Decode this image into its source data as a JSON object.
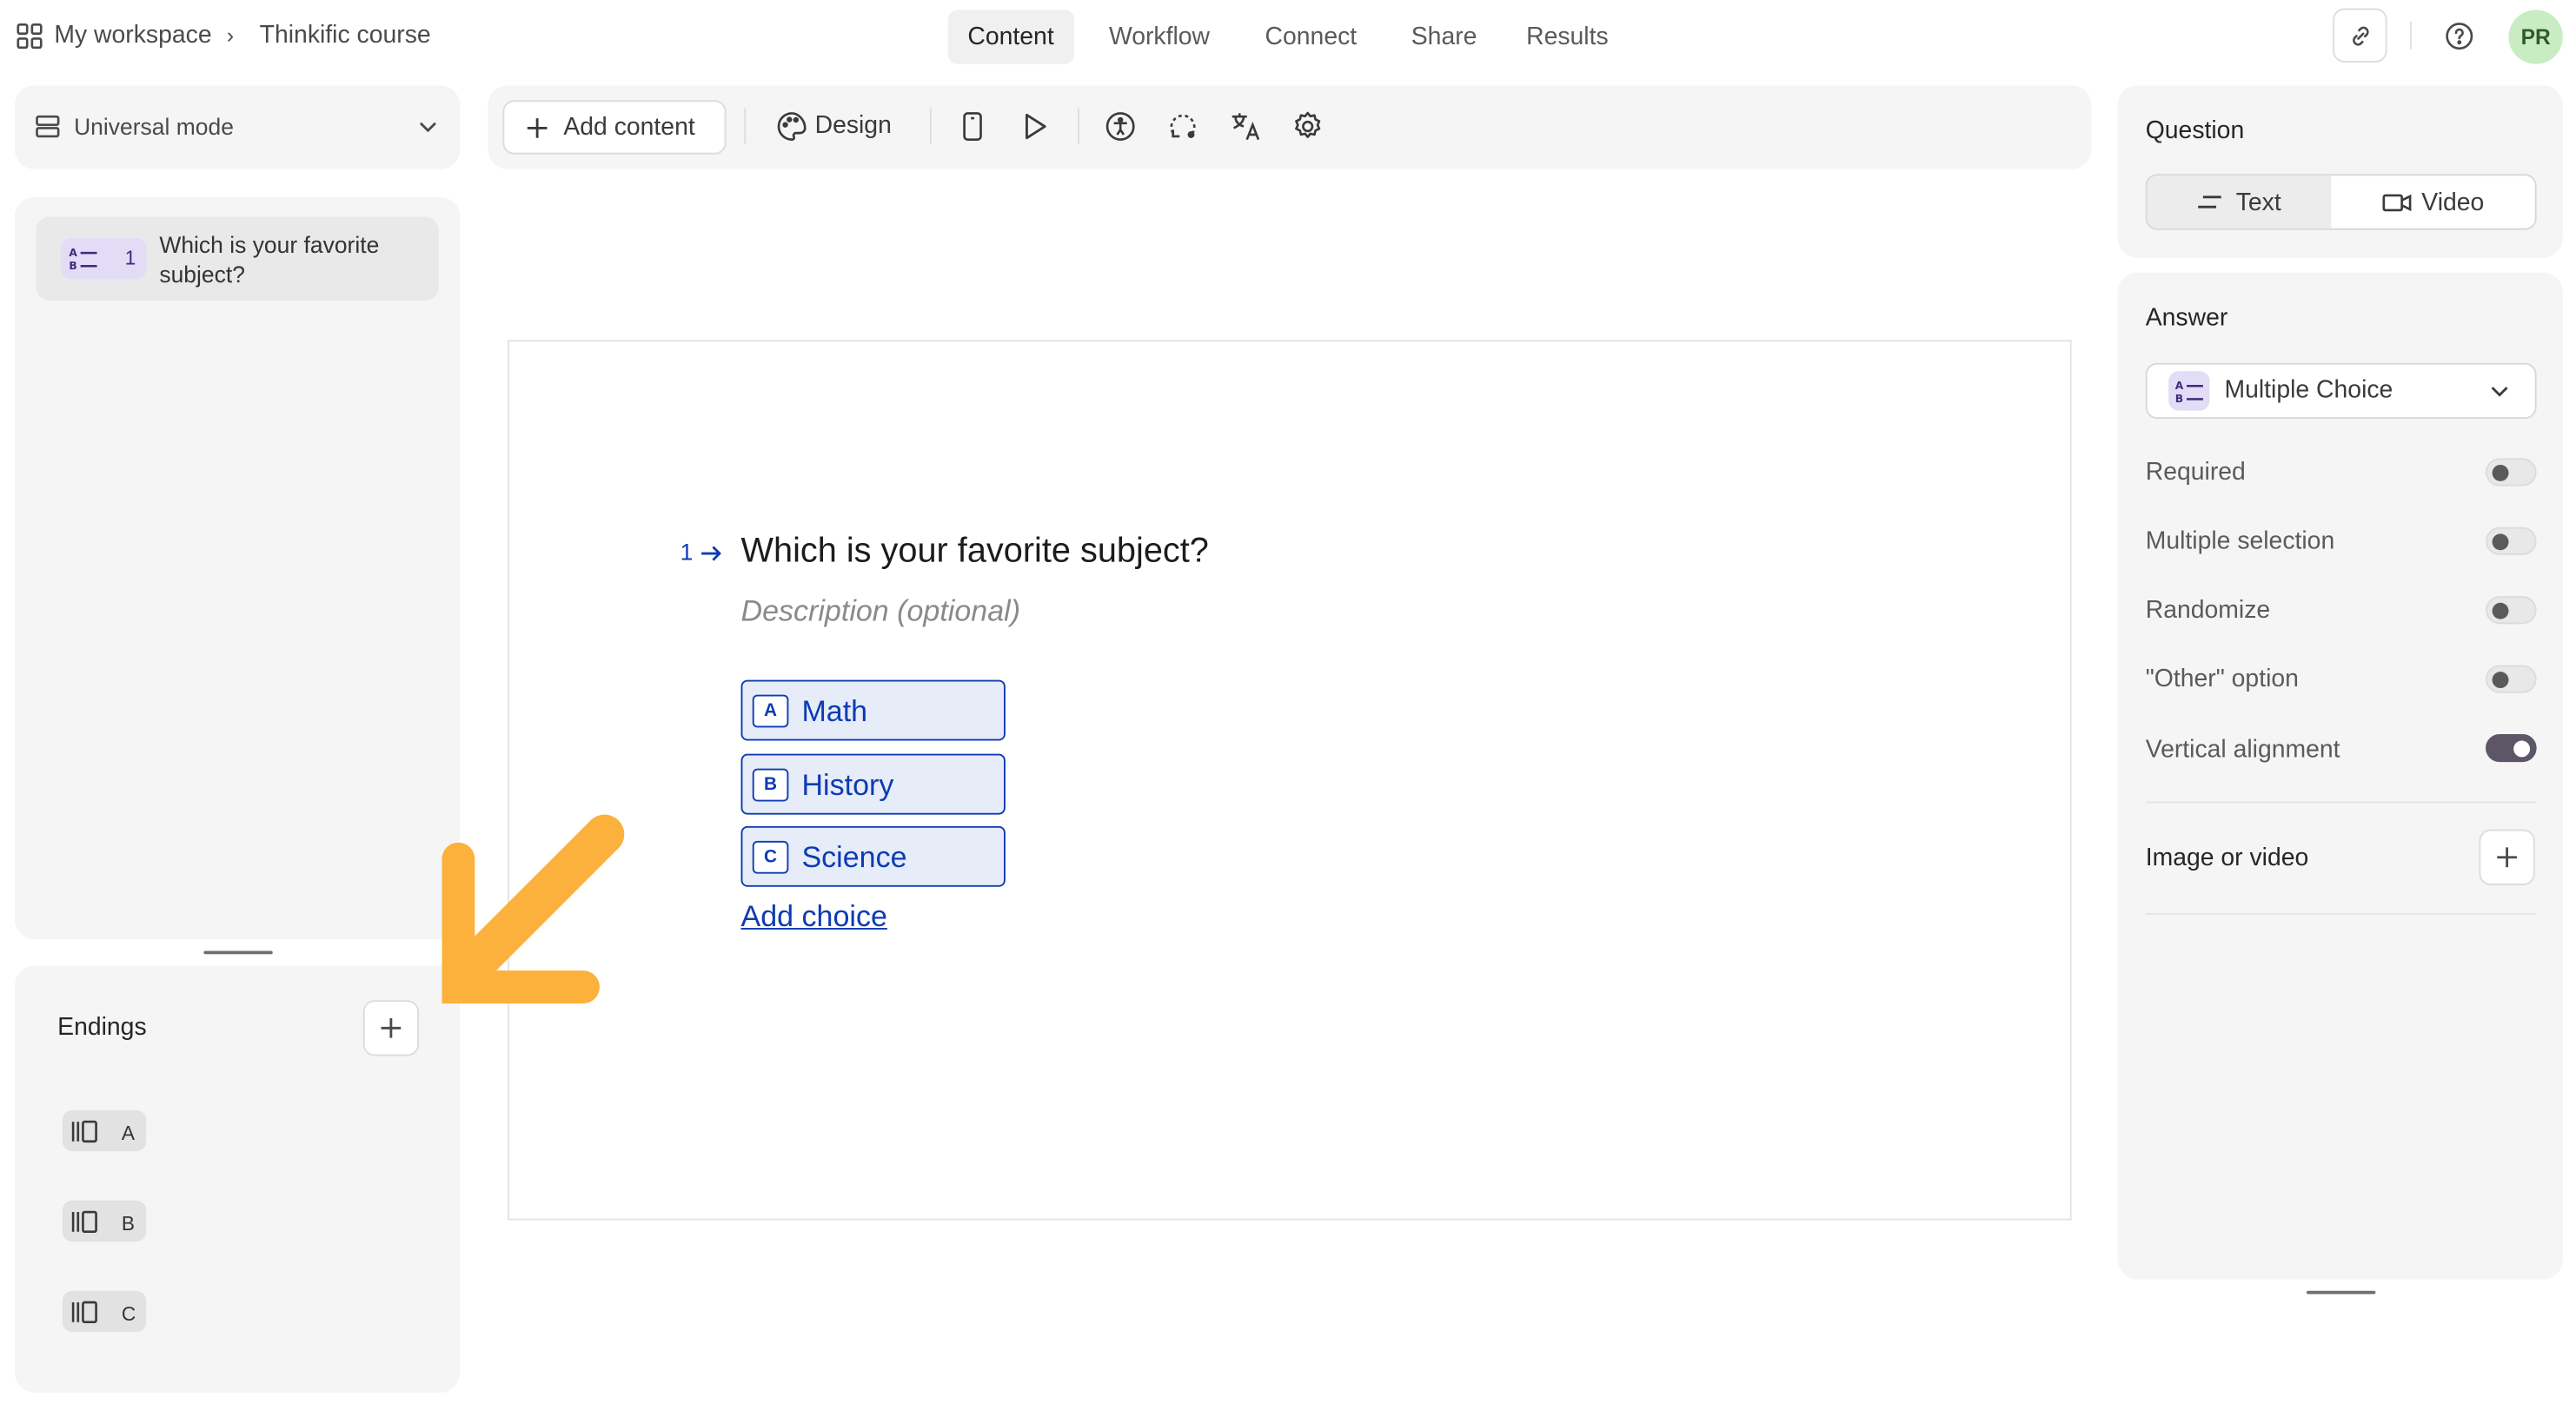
{
  "breadcrumb": {
    "workspace": "My workspace",
    "separator": "›",
    "course": "Thinkific course"
  },
  "nav_tabs": [
    {
      "label": "Content",
      "active": true
    },
    {
      "label": "Workflow",
      "active": false
    },
    {
      "label": "Connect",
      "active": false
    },
    {
      "label": "Share",
      "active": false
    },
    {
      "label": "Results",
      "active": false
    }
  ],
  "header_actions": {
    "link_icon": "link-icon",
    "help_icon": "help-icon",
    "avatar_initials": "PR",
    "avatar_color": "#c9ecc4"
  },
  "left_panel": {
    "mode_label": "Universal mode",
    "questions": [
      {
        "number": "1",
        "text": "Which is your favorite subject?",
        "type_icon": "multiple-choice-icon"
      }
    ],
    "endings_title": "Endings",
    "endings": [
      {
        "letter": "A"
      },
      {
        "letter": "B"
      },
      {
        "letter": "C"
      }
    ]
  },
  "toolbar": {
    "add_content_label": "Add content",
    "design_label": "Design",
    "icons": [
      "palette-icon",
      "mobile-preview-icon",
      "play-icon",
      "accessibility-icon",
      "logic-icon",
      "translate-icon",
      "settings-icon"
    ]
  },
  "canvas": {
    "question_index": "1",
    "question_title": "Which is your favorite subject?",
    "description_placeholder": "Description (optional)",
    "choices": [
      {
        "key": "A",
        "label": "Math"
      },
      {
        "key": "B",
        "label": "History"
      },
      {
        "key": "C",
        "label": "Science"
      }
    ],
    "add_choice_label": "Add choice",
    "accent_color": "#0d3bb3"
  },
  "right_panel": {
    "question_title": "Question",
    "question_type_tabs": [
      {
        "label": "Text",
        "selected": true
      },
      {
        "label": "Video",
        "selected": false
      }
    ],
    "answer_title": "Answer",
    "answer_type": "Multiple Choice",
    "options": [
      {
        "label": "Required",
        "on": false
      },
      {
        "label": "Multiple selection",
        "on": false
      },
      {
        "label": "Randomize",
        "on": false
      },
      {
        "label": "\"Other\" option",
        "on": false
      },
      {
        "label": "Vertical alignment",
        "on": true
      }
    ],
    "media_title": "Image or video"
  },
  "annotation": {
    "arrow_color": "#fbb13c"
  }
}
